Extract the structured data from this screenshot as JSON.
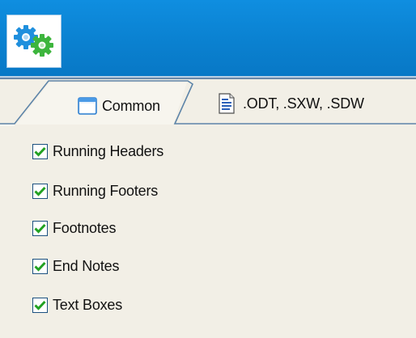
{
  "header": {
    "app_icon": "gears-icon",
    "brand_colors": {
      "bar": "#0a82d0",
      "gear_blue": "#1f8fdd",
      "gear_green": "#3db53d"
    }
  },
  "tabs": [
    {
      "label": "Common",
      "icon": "window-icon",
      "selected": true
    },
    {
      "label": ".ODT, .SXW, .SDW",
      "icon": "document-icon",
      "selected": false
    }
  ],
  "options": [
    {
      "label": "Running Headers",
      "checked": true
    },
    {
      "label": "Running Footers",
      "checked": true
    },
    {
      "label": "Footnotes",
      "checked": true
    },
    {
      "label": "End Notes",
      "checked": true
    },
    {
      "label": "Text Boxes",
      "checked": true
    }
  ],
  "colors": {
    "check_mark": "#21a121",
    "checkbox_border": "#1c5180",
    "panel_bg": "#f2efe6"
  }
}
